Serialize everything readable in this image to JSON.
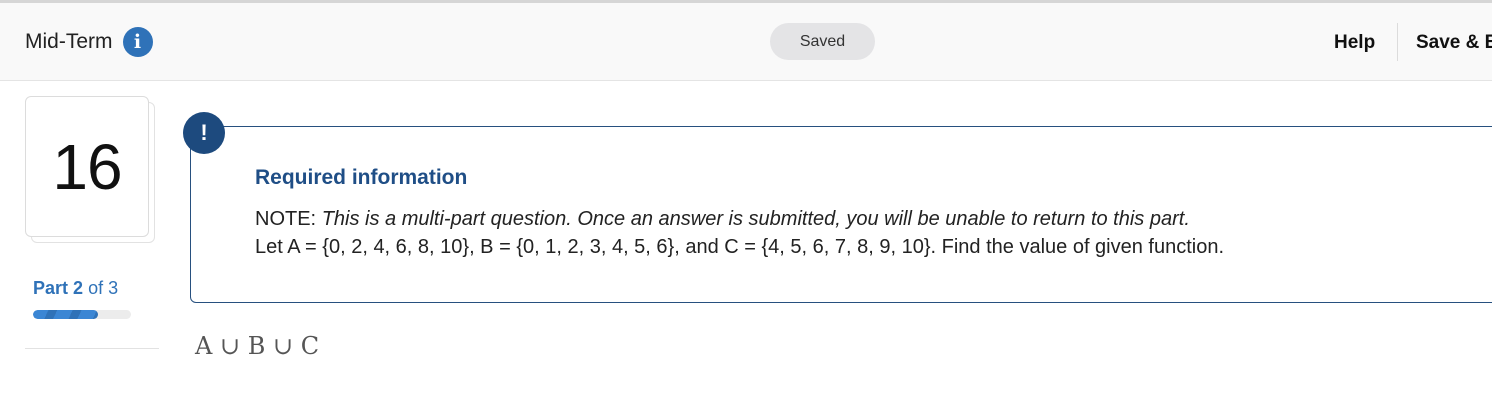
{
  "header": {
    "title": "Mid-Term",
    "info_icon": "info-icon",
    "status": "Saved",
    "help_label": "Help",
    "save_exit_label": "Save & E"
  },
  "question": {
    "number": "16",
    "part_label": "Part",
    "part_current": "2",
    "part_of": "of 3",
    "progress_fraction": 0.667
  },
  "info": {
    "alert_symbol": "!",
    "title": "Required information",
    "note_prefix": "NOTE:",
    "note_text": "This is a multi-part question. Once an answer is submitted, you will be unable to return to this part.",
    "let_text": "Let A = {0, 2, 4, 6, 8, 10}, B = {0, 1, 2, 3, 4, 5, 6}, and C = {4, 5, 6, 7, 8, 9, 10}. Find the value of given function."
  },
  "expression": "A ∪ B ∪ C",
  "colors": {
    "accent": "#2f72b8",
    "info_border": "#27507f",
    "alert_bg": "#1d4a7e",
    "title_blue": "#1f4e86"
  }
}
